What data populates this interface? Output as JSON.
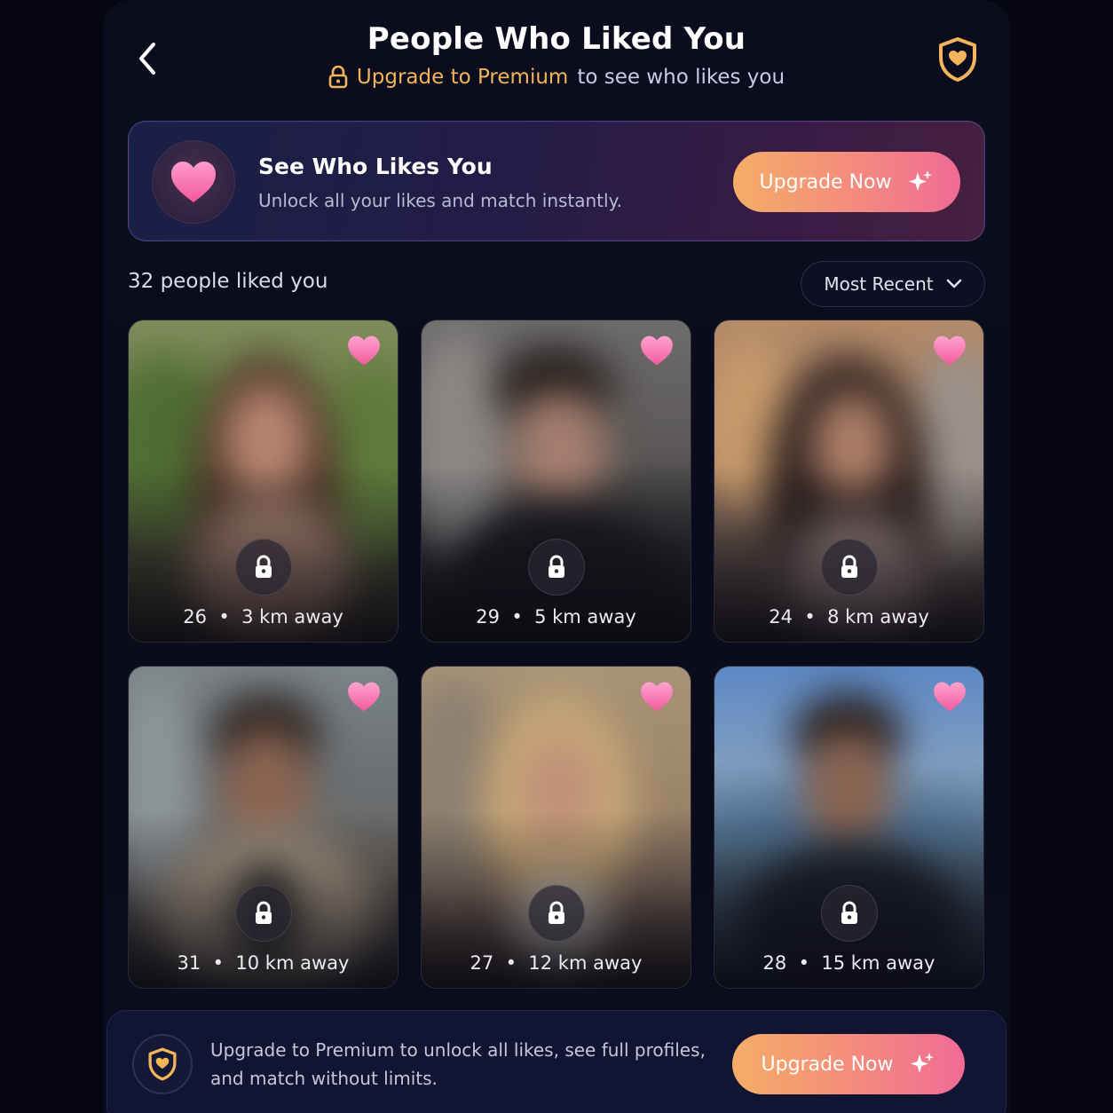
{
  "header": {
    "title": "People Who Liked You",
    "subtitle_accent": "Upgrade to Premium",
    "subtitle_rest": "to see who likes you"
  },
  "banner": {
    "title": "See Who Likes You",
    "subtitle": "Unlock all your likes and match instantly.",
    "button_label": "Upgrade Now"
  },
  "list": {
    "count_label": "32 people liked you",
    "sort_label": "Most Recent"
  },
  "profiles": [
    {
      "age": "26",
      "distance": "3 km away"
    },
    {
      "age": "29",
      "distance": "5 km away"
    },
    {
      "age": "24",
      "distance": "8 km away"
    },
    {
      "age": "31",
      "distance": "10 km away"
    },
    {
      "age": "27",
      "distance": "12 km away"
    },
    {
      "age": "28",
      "distance": "15 km away"
    }
  ],
  "bottom_bar": {
    "line1": "Upgrade to Premium to unlock all likes, see full profiles,",
    "line2": "and match without limits.",
    "button_label": "Upgrade Now"
  },
  "colors": {
    "accent_gold": "#f3b45a",
    "heart_pink": "#f46aa6",
    "button_gradient_start": "#f4ad66",
    "button_gradient_end": "#f06b96"
  },
  "icons": [
    "chevron-left-icon",
    "lock-icon",
    "shield-heart-icon",
    "heart-icon",
    "sparkle-icon",
    "chevron-down-icon"
  ]
}
